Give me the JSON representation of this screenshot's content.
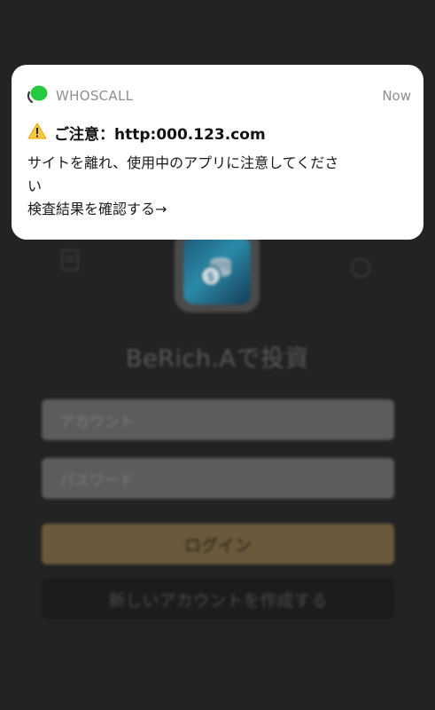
{
  "notification": {
    "app_name": "WHOSCALL",
    "time": "Now",
    "title": "ご注意：http:000.123.com",
    "body_line1": "サイトを離れ、使用中のアプリに注意してくださ",
    "body_line2": "い",
    "body_line3": "検査結果を確認する→",
    "icons": {
      "app": "whoscall-icon",
      "warning": "warning-icon"
    },
    "colors": {
      "accent": "#27c93f",
      "warning": "#f6c744"
    }
  },
  "app": {
    "title": "BeRich.Aで投資",
    "account_placeholder": "アカウント",
    "password_placeholder": "パスワード",
    "login_label": "ログイン",
    "register_label": "新しいアカウントを作成する",
    "colors": {
      "login_button": "#6a5a3b",
      "background": "#232323"
    }
  }
}
